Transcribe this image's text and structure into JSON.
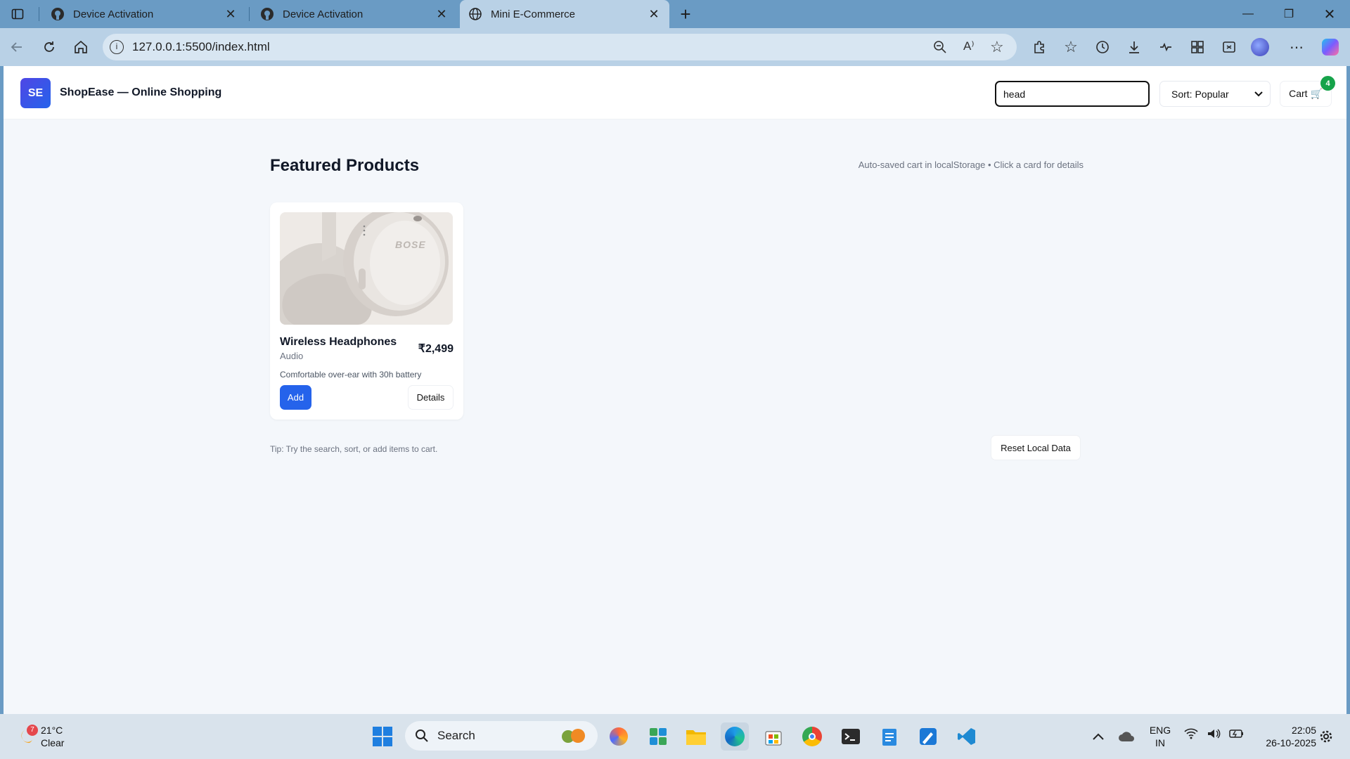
{
  "browser": {
    "tabs": [
      {
        "title": "Device Activation",
        "icon": "github-icon",
        "active": false
      },
      {
        "title": "Device Activation",
        "icon": "github-icon",
        "active": false
      },
      {
        "title": "Mini E-Commerce",
        "icon": "globe-icon",
        "active": true
      }
    ],
    "url": "127.0.0.1:5500/index.html"
  },
  "header": {
    "logo_text": "SE",
    "brand": "ShopEase — Online Shopping",
    "search_value": "head",
    "sort_label": "Sort: Popular",
    "cart_label": "Cart 🛒",
    "cart_count": "4"
  },
  "main": {
    "title": "Featured Products",
    "note": "Auto-saved cart in localStorage • Click a card for details",
    "products": [
      {
        "name": "Wireless Headphones",
        "category": "Audio",
        "price": "₹2,499",
        "description": "Comfortable over-ear with 30h battery",
        "add_label": "Add",
        "details_label": "Details",
        "brand_mark": "BOSE"
      }
    ],
    "tip": "Tip: Try the search, sort, or add items to cart.",
    "reset_label": "Reset Local Data"
  },
  "taskbar": {
    "weather_badge": "7",
    "temperature": "21°C",
    "condition": "Clear",
    "search_label": "Search",
    "lang_top": "ENG",
    "lang_bottom": "IN",
    "time": "22:05",
    "date": "26-10-2025"
  },
  "colors": {
    "accent": "#2563eb",
    "badge": "#16a34a",
    "tab_strip": "#6a9bc4"
  }
}
